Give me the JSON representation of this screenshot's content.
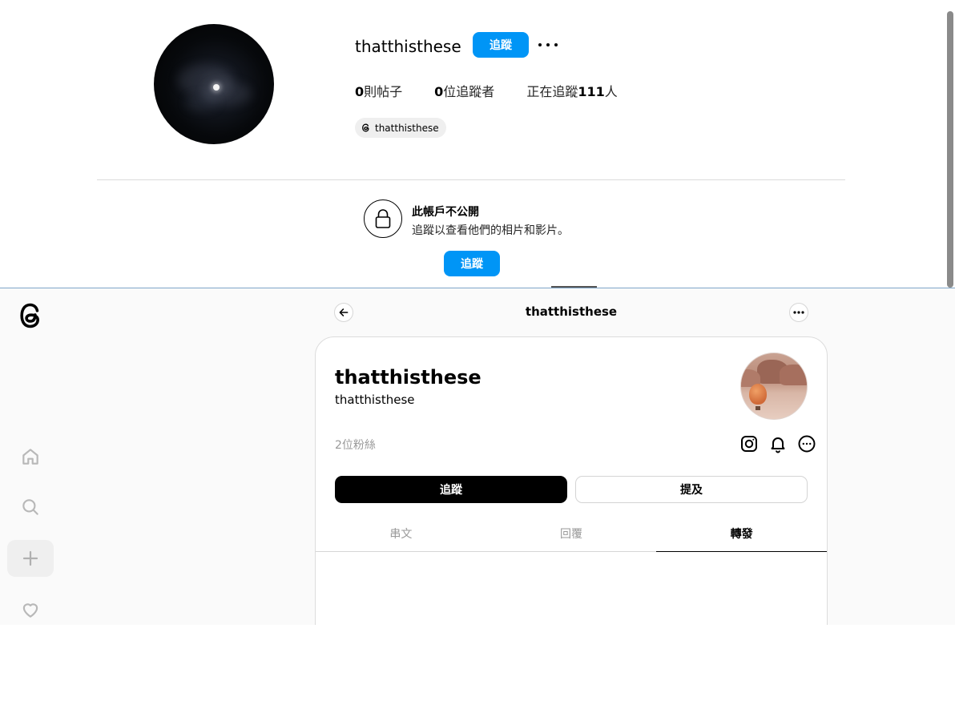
{
  "instagram": {
    "username": "thatthisthese",
    "follow_label": "追蹤",
    "stats": {
      "posts_count": "0",
      "posts_label": "則帖子",
      "followers_count": "0",
      "followers_label": "位追蹤者",
      "following_prefix": "正在追蹤",
      "following_count": "111",
      "following_suffix": "人"
    },
    "threads_badge": "thatthisthese",
    "private": {
      "title": "此帳戶不公開",
      "subtitle": "追蹤以查看他們的相片和影片。",
      "follow_label": "追蹤"
    },
    "colors": {
      "accent": "#0095f6"
    }
  },
  "threads": {
    "header_title": "thatthisthese",
    "profile": {
      "name": "thatthisthese",
      "handle": "thatthisthese",
      "followers": "2位粉絲"
    },
    "buttons": {
      "follow": "追蹤",
      "mention": "提及"
    },
    "tabs": [
      {
        "label": "串文"
      },
      {
        "label": "回覆"
      },
      {
        "label": "轉發"
      }
    ],
    "active_tab": "轉發",
    "nav_icons": [
      "home-icon",
      "search-icon",
      "plus-icon",
      "heart-icon"
    ]
  }
}
